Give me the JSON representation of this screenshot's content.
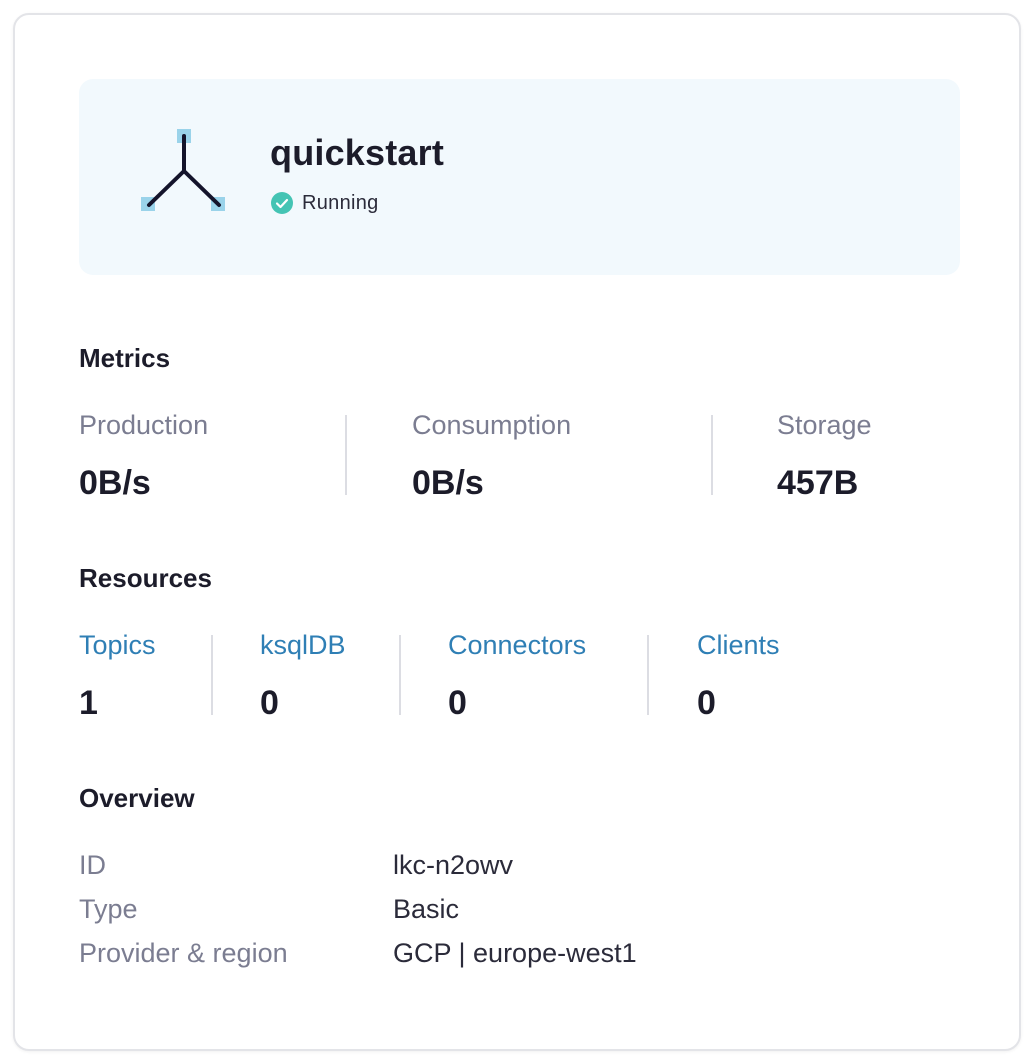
{
  "cluster": {
    "name": "quickstart",
    "status": "Running",
    "status_color": "#44c4b4",
    "icon": "cluster-network-icon"
  },
  "metrics": {
    "title": "Metrics",
    "production": {
      "label": "Production",
      "value": "0B/s"
    },
    "consumption": {
      "label": "Consumption",
      "value": "0B/s"
    },
    "storage": {
      "label": "Storage",
      "value": "457B"
    }
  },
  "resources": {
    "title": "Resources",
    "topics": {
      "label": "Topics",
      "value": "1"
    },
    "ksqldb": {
      "label": "ksqlDB",
      "value": "0"
    },
    "connectors": {
      "label": "Connectors",
      "value": "0"
    },
    "clients": {
      "label": "Clients",
      "value": "0"
    },
    "link_color": "#2f7fb5"
  },
  "overview": {
    "title": "Overview",
    "rows": [
      {
        "label": "ID",
        "value": "lkc-n2owv"
      },
      {
        "label": "Type",
        "value": "Basic"
      },
      {
        "label": "Provider & region",
        "value": "GCP | europe-west1"
      }
    ]
  }
}
